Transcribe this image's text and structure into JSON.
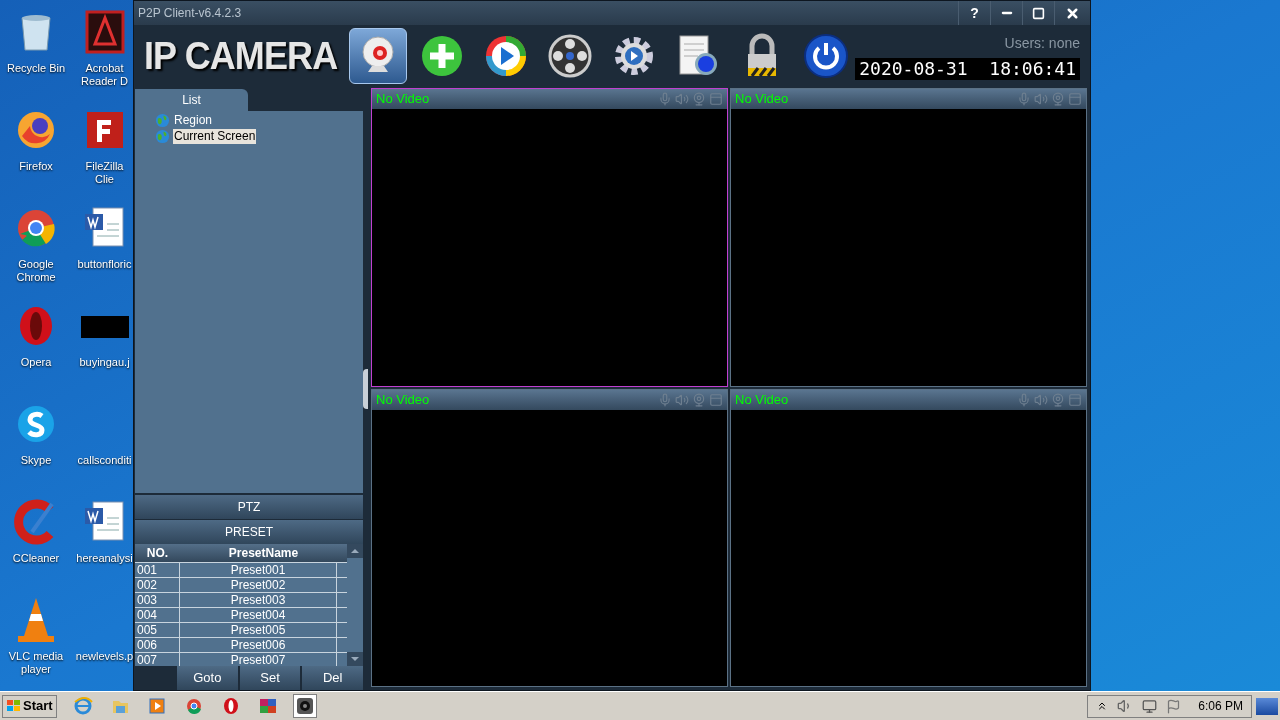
{
  "desktop": {
    "icons": [
      {
        "label": "Recycle Bin"
      },
      {
        "label": "Acrobat Reader D"
      },
      {
        "label": "Firefox"
      },
      {
        "label": "FileZilla Clie"
      },
      {
        "label": "Google Chrome"
      },
      {
        "label": "buttonfloric"
      },
      {
        "label": "Opera"
      },
      {
        "label": "buyingau.j"
      },
      {
        "label": "Skype"
      },
      {
        "label": "callsconditi"
      },
      {
        "label": "CCleaner"
      },
      {
        "label": "hereanalysi"
      },
      {
        "label": "VLC media player"
      },
      {
        "label": "newlevels.p"
      }
    ]
  },
  "window": {
    "title": "P2P Client-v6.4.2.3",
    "help": "?",
    "logo": "IP CAMERA",
    "toolbar": [
      {
        "selected": true
      },
      {
        "selected": false
      },
      {
        "selected": false
      },
      {
        "selected": false
      },
      {
        "selected": false
      },
      {
        "selected": false
      },
      {
        "selected": false
      },
      {
        "selected": false
      }
    ],
    "users": "Users: none",
    "datetime": "2020-08-31  18:06:41",
    "list_tab": {
      "label": "List",
      "selected": true
    },
    "tree": [
      {
        "label": "Region",
        "selected": false
      },
      {
        "label": "Current Screen",
        "selected": true
      }
    ],
    "ptz": "PTZ",
    "preset": "PRESET",
    "table": {
      "columns": [
        "NO.",
        "PresetName"
      ],
      "rows": [
        [
          "001",
          "Preset001"
        ],
        [
          "002",
          "Preset002"
        ],
        [
          "003",
          "Preset003"
        ],
        [
          "004",
          "Preset004"
        ],
        [
          "005",
          "Preset005"
        ],
        [
          "006",
          "Preset006"
        ],
        [
          "007",
          "Preset007"
        ]
      ]
    },
    "buttons": [
      "Goto",
      "Set",
      "Del"
    ],
    "videos": [
      {
        "label": "No Video",
        "selected": true
      },
      {
        "label": "No Video",
        "selected": false
      },
      {
        "label": "No Video",
        "selected": false
      },
      {
        "label": "No Video",
        "selected": false
      }
    ]
  },
  "taskbar": {
    "start": "Start",
    "apps": [
      {
        "selected": false
      },
      {
        "selected": false
      },
      {
        "selected": false
      },
      {
        "selected": false
      },
      {
        "selected": false
      },
      {
        "selected": false
      },
      {
        "selected": true
      }
    ],
    "clock": "6:06 PM"
  }
}
